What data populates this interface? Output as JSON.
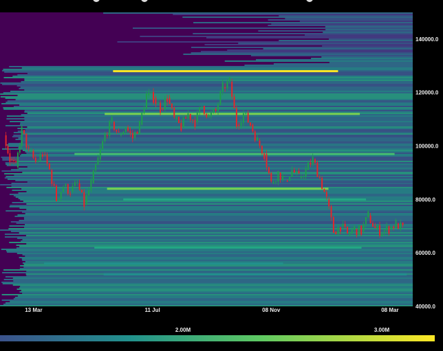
{
  "chart_data": {
    "type": "heatmap",
    "overlay": "candlestick",
    "x_ticks": [
      "13 Mar",
      "11 Jul",
      "08 Nov",
      "08 Mar"
    ],
    "y_ticks": [
      "40000.0",
      "60000.0",
      "80000.0",
      "100000.0",
      "120000.0",
      "140000.0"
    ],
    "ylim": [
      40000,
      150000
    ],
    "colorbar": {
      "ticks": [
        "2.00M",
        "3.00M"
      ],
      "colormap": "viridis"
    },
    "price_path": [
      {
        "x": "2024-02-12",
        "y": 104000
      },
      {
        "x": "2024-02-18",
        "y": 95000
      },
      {
        "x": "2024-02-24",
        "y": 92000
      },
      {
        "x": "2024-03-01",
        "y": 106000
      },
      {
        "x": "2024-03-08",
        "y": 98000
      },
      {
        "x": "2024-03-15",
        "y": 94000
      },
      {
        "x": "2024-03-22",
        "y": 97000
      },
      {
        "x": "2024-03-29",
        "y": 91000
      },
      {
        "x": "2024-04-05",
        "y": 80000
      },
      {
        "x": "2024-04-12",
        "y": 85000
      },
      {
        "x": "2024-04-19",
        "y": 83000
      },
      {
        "x": "2024-04-26",
        "y": 86000
      },
      {
        "x": "2024-05-03",
        "y": 78000
      },
      {
        "x": "2024-05-10",
        "y": 86000
      },
      {
        "x": "2024-05-17",
        "y": 95000
      },
      {
        "x": "2024-05-24",
        "y": 104000
      },
      {
        "x": "2024-05-31",
        "y": 109000
      },
      {
        "x": "2024-06-07",
        "y": 104000
      },
      {
        "x": "2024-06-14",
        "y": 107000
      },
      {
        "x": "2024-06-21",
        "y": 103000
      },
      {
        "x": "2024-06-28",
        "y": 108000
      },
      {
        "x": "2024-07-05",
        "y": 119000
      },
      {
        "x": "2024-07-12",
        "y": 118000
      },
      {
        "x": "2024-07-19",
        "y": 114000
      },
      {
        "x": "2024-07-26",
        "y": 118000
      },
      {
        "x": "2024-08-02",
        "y": 110000
      },
      {
        "x": "2024-08-09",
        "y": 107000
      },
      {
        "x": "2024-08-16",
        "y": 112000
      },
      {
        "x": "2024-08-23",
        "y": 109000
      },
      {
        "x": "2024-08-30",
        "y": 115000
      },
      {
        "x": "2024-09-06",
        "y": 111000
      },
      {
        "x": "2024-09-13",
        "y": 113000
      },
      {
        "x": "2024-09-20",
        "y": 122000
      },
      {
        "x": "2024-09-27",
        "y": 124000
      },
      {
        "x": "2024-10-04",
        "y": 108000
      },
      {
        "x": "2024-10-11",
        "y": 112000
      },
      {
        "x": "2024-10-18",
        "y": 108000
      },
      {
        "x": "2024-10-25",
        "y": 102000
      },
      {
        "x": "2024-11-01",
        "y": 97000
      },
      {
        "x": "2024-11-08",
        "y": 86000
      },
      {
        "x": "2024-11-15",
        "y": 90000
      },
      {
        "x": "2024-11-22",
        "y": 87000
      },
      {
        "x": "2024-11-29",
        "y": 91000
      },
      {
        "x": "2024-12-06",
        "y": 88000
      },
      {
        "x": "2024-12-13",
        "y": 91000
      },
      {
        "x": "2024-12-20",
        "y": 95000
      },
      {
        "x": "2024-12-27",
        "y": 88000
      },
      {
        "x": "2025-01-03",
        "y": 80000
      },
      {
        "x": "2025-01-10",
        "y": 68000
      },
      {
        "x": "2025-01-17",
        "y": 70000
      },
      {
        "x": "2025-01-24",
        "y": 67000
      },
      {
        "x": "2025-01-31",
        "y": 69000
      },
      {
        "x": "2025-02-07",
        "y": 68000
      },
      {
        "x": "2025-02-14",
        "y": 74000
      },
      {
        "x": "2025-02-21",
        "y": 69000
      },
      {
        "x": "2025-02-28",
        "y": 68000
      },
      {
        "x": "2025-03-07",
        "y": 69000
      },
      {
        "x": "2025-03-14",
        "y": 71000
      },
      {
        "x": "2025-03-21",
        "y": 69000
      }
    ],
    "liquidity_bands": [
      {
        "y": 128000,
        "level": 0.95
      },
      {
        "y": 112000,
        "level": 0.8
      },
      {
        "y": 97000,
        "level": 0.7
      },
      {
        "y": 84000,
        "level": 0.75
      },
      {
        "y": 80000,
        "level": 0.6
      },
      {
        "y": 62000,
        "level": 0.55
      },
      {
        "y": 56000,
        "level": 0.5
      },
      {
        "y": 52000,
        "level": 0.45
      }
    ]
  }
}
